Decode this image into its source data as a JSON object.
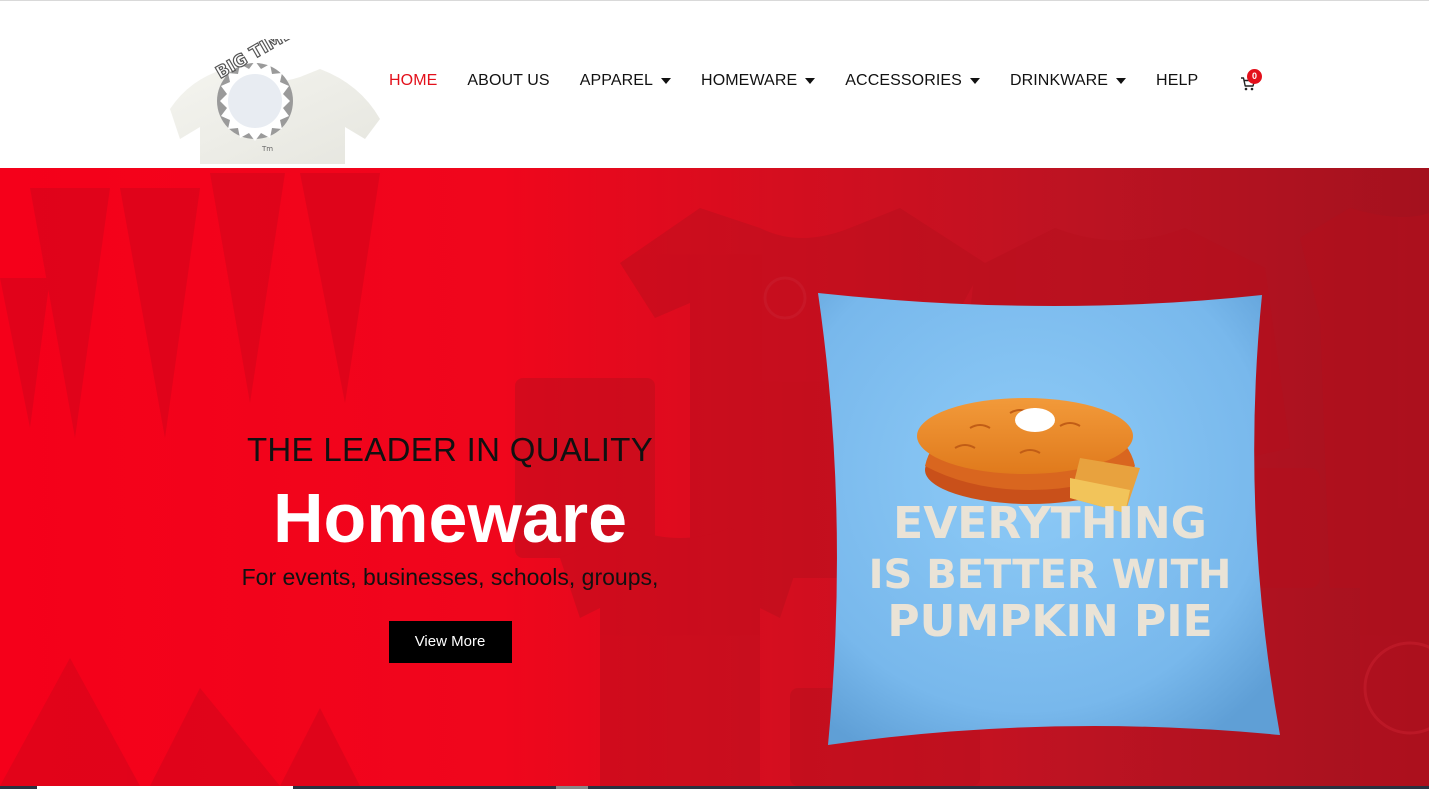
{
  "logo": {
    "text": "BIG TIME",
    "alt": "Big Time logo"
  },
  "nav": {
    "items": [
      {
        "label": "HOME",
        "active": true,
        "dropdown": false
      },
      {
        "label": "ABOUT US",
        "active": false,
        "dropdown": false
      },
      {
        "label": "APPAREL",
        "active": false,
        "dropdown": true
      },
      {
        "label": "HOMEWARE",
        "active": false,
        "dropdown": true
      },
      {
        "label": "ACCESSORIES",
        "active": false,
        "dropdown": true
      },
      {
        "label": "DRINKWARE",
        "active": false,
        "dropdown": true
      },
      {
        "label": "HELP",
        "active": false,
        "dropdown": false
      }
    ]
  },
  "cart": {
    "count": "0",
    "icon": "cart-icon"
  },
  "hero": {
    "kicker": "THE LEADER IN QUALITY",
    "title": "Homeware",
    "subtitle": "For events, businesses, schools, groups,",
    "button_label": "View More",
    "product": {
      "line1": "EVERYTHING",
      "line2": "IS BETTER WITH",
      "line3": "PUMPKIN PIE"
    }
  },
  "colors": {
    "accent": "#e3101b",
    "hero_red": "#f5001a",
    "pillow_blue": "#7fbff0",
    "button": "#000000"
  }
}
